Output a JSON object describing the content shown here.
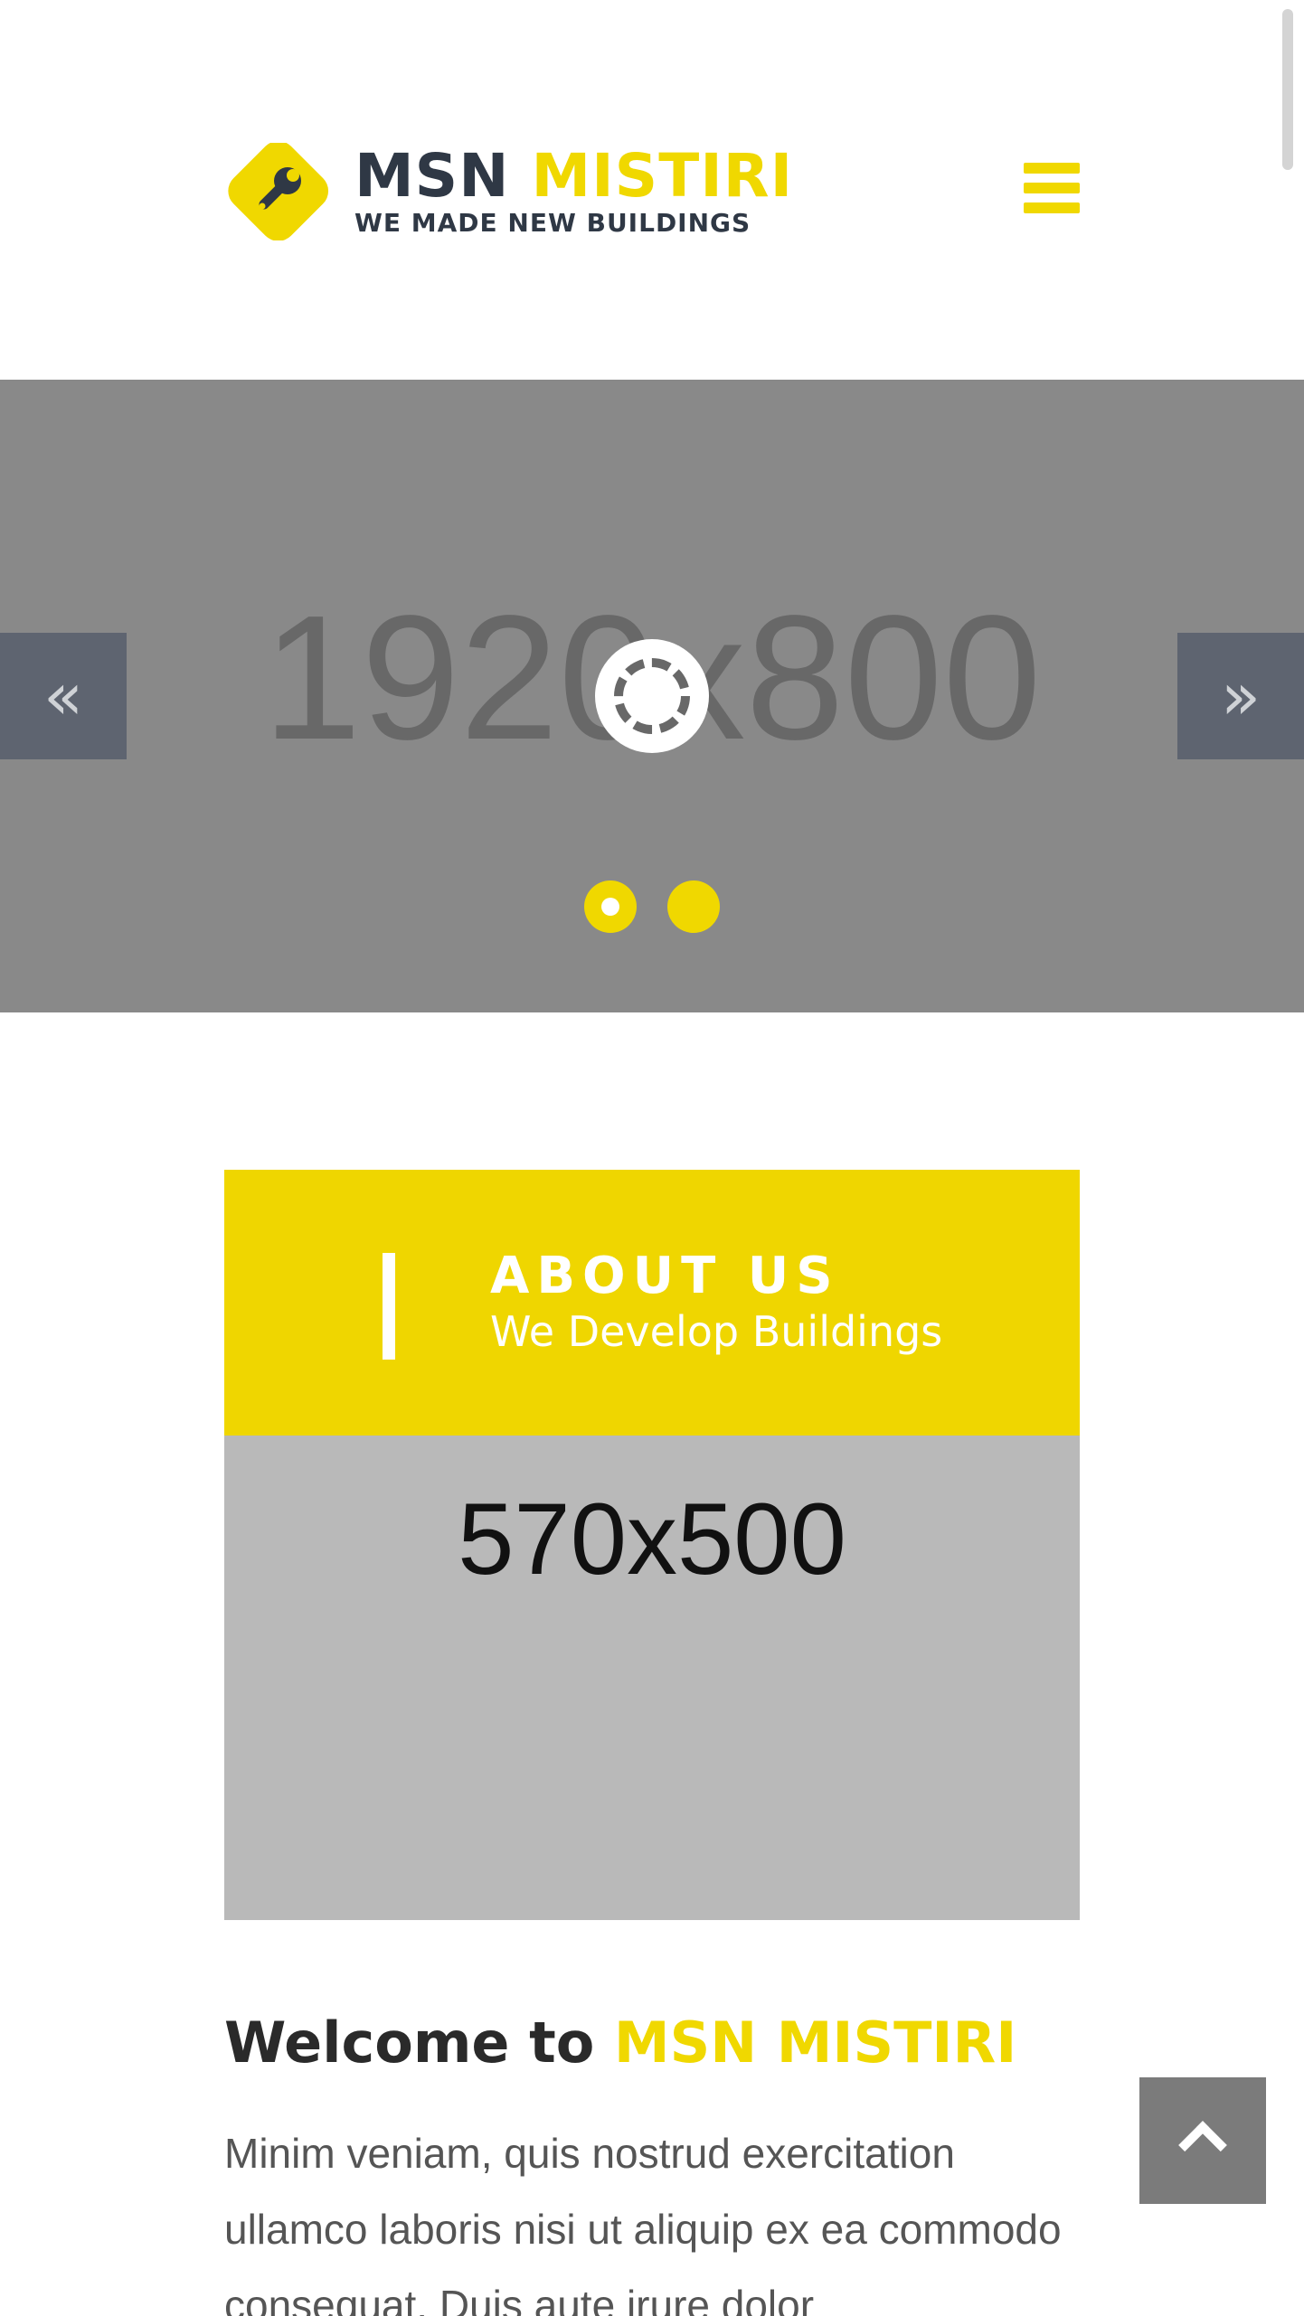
{
  "header": {
    "logo": {
      "brand_part1": "MSN",
      "brand_part2": "MISTIRI",
      "tagline": "WE MADE NEW BUILDINGS"
    },
    "menu_icon": "hamburger-menu-icon"
  },
  "slider": {
    "placeholder_text": "1920x800",
    "prev_glyph": "«",
    "next_glyph": "»",
    "slides_count": 2,
    "active_slide": 1
  },
  "about": {
    "title": "ABOUT US",
    "subtitle": "We Develop Buildings",
    "image_placeholder": "570x500"
  },
  "welcome": {
    "prefix": "Welcome to",
    "brand": "MSN MISTIRI",
    "paragraph": "Minim veniam, quis nostrud exercitation ullamco laboris nisi ut aliquip ex ea commodo consequat. Duis aute irure dolor"
  },
  "colors": {
    "accent": "#f0d800",
    "dark": "#2f3845",
    "slider_bg": "#898989",
    "arrow_bg": "#5e6470"
  }
}
